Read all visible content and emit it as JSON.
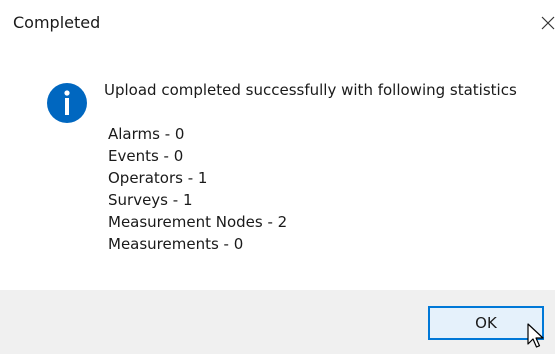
{
  "window": {
    "title": "Completed",
    "close_icon": "close-icon"
  },
  "dialog": {
    "icon": "info-icon",
    "icon_color": "#0067c0",
    "message": "Upload completed successfully with following statistics",
    "stats": [
      "Alarms - 0",
      "Events - 0",
      "Operators - 1",
      "Surveys - 1",
      "Measurement Nodes - 2",
      "Measurements - 0"
    ]
  },
  "footer": {
    "ok_label": "OK",
    "accent": "#0078d7"
  },
  "cursor": "mouse-pointer-icon"
}
